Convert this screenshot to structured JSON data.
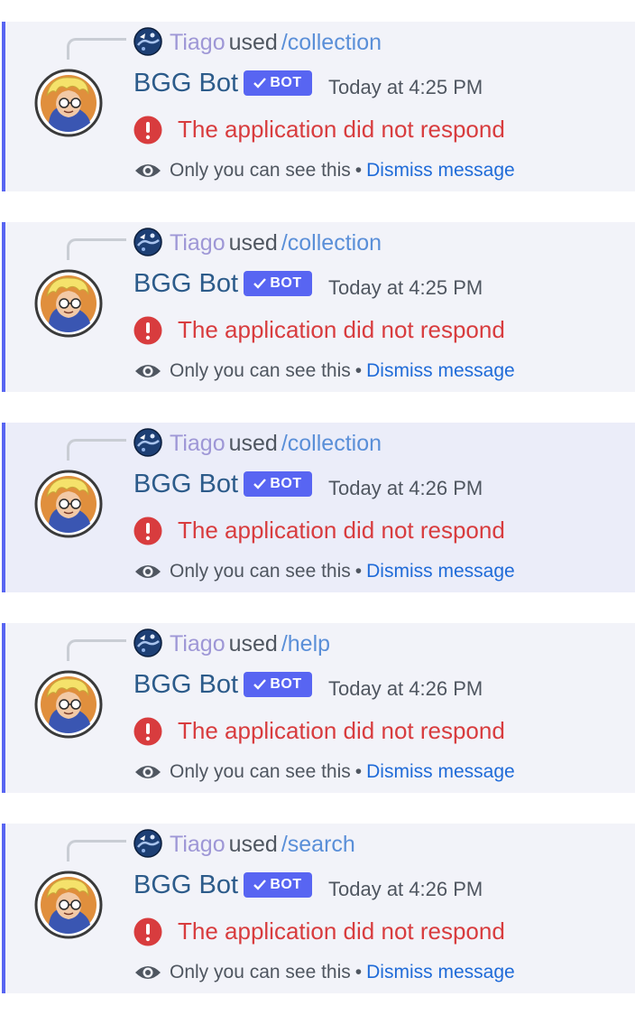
{
  "messages": [
    {
      "reply_user": "Tiago",
      "reply_verb": "used",
      "reply_command": "/collection",
      "bot_name": "BGG Bot",
      "badge": "BOT",
      "timestamp": "Today at 4:25 PM",
      "error": "The application did not respond",
      "ephemeral_note": "Only you can see this",
      "separator": "•",
      "dismiss": "Dismiss message"
    },
    {
      "reply_user": "Tiago",
      "reply_verb": "used",
      "reply_command": "/collection",
      "bot_name": "BGG Bot",
      "badge": "BOT",
      "timestamp": "Today at 4:25 PM",
      "error": "The application did not respond",
      "ephemeral_note": "Only you can see this",
      "separator": "•",
      "dismiss": "Dismiss message"
    },
    {
      "reply_user": "Tiago",
      "reply_verb": "used",
      "reply_command": "/collection",
      "bot_name": "BGG Bot",
      "badge": "BOT",
      "timestamp": "Today at 4:26 PM",
      "error": "The application did not respond",
      "ephemeral_note": "Only you can see this",
      "separator": "•",
      "dismiss": "Dismiss message"
    },
    {
      "reply_user": "Tiago",
      "reply_verb": "used",
      "reply_command": "/help",
      "bot_name": "BGG Bot",
      "badge": "BOT",
      "timestamp": "Today at 4:26 PM",
      "error": "The application did not respond",
      "ephemeral_note": "Only you can see this",
      "separator": "•",
      "dismiss": "Dismiss message"
    },
    {
      "reply_user": "Tiago",
      "reply_verb": "used",
      "reply_command": "/search",
      "bot_name": "BGG Bot",
      "badge": "BOT",
      "timestamp": "Today at 4:26 PM",
      "error": "The application did not respond",
      "ephemeral_note": "Only you can see this",
      "separator": "•",
      "dismiss": "Dismiss message"
    }
  ],
  "colors": {
    "accent": "#5865f2",
    "message_bg": "#f2f3f9",
    "error": "#d83c3e",
    "link": "#1f6bd8",
    "bot_name": "#2c5b8a",
    "reply_user": "#9e97d6"
  },
  "icons": {
    "reply_avatar": "user-avatar-icon",
    "bot_avatar": "bot-avatar-icon",
    "verified": "checkmark-icon",
    "error": "exclamation-circle-icon",
    "visibility": "eye-icon"
  }
}
